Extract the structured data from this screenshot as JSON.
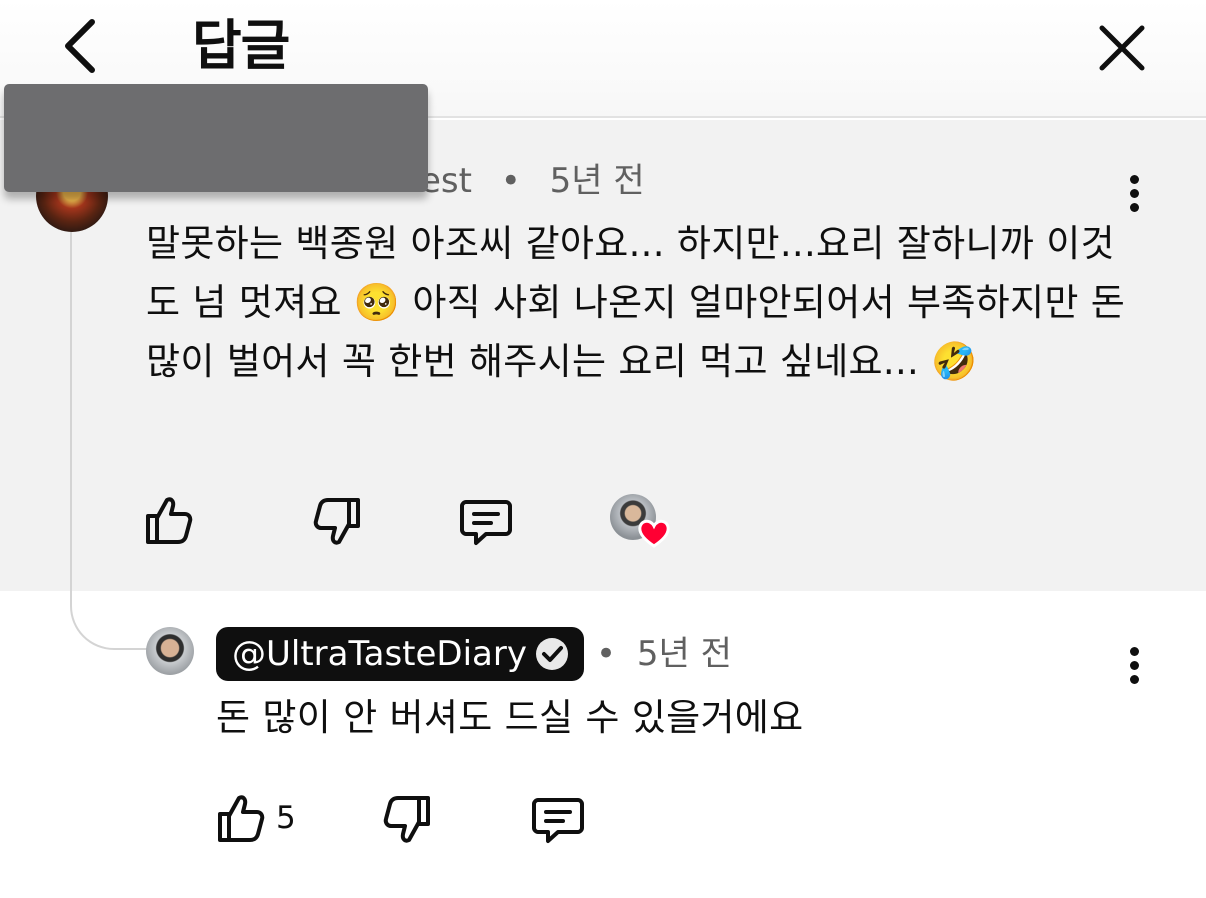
{
  "header": {
    "title": "답글",
    "back_icon": "chevron-left-icon",
    "close_icon": "close-icon"
  },
  "parent_comment": {
    "author_visible_fragment": "est",
    "separator": "•",
    "time": "5년 전",
    "text": "말못하는 백종원 아조씨 같아요... 하지만...요리 잘하니까 이것도 넘 멋져요 🥺 아직 사회 나온지 얼마안되어서 부족하지만 돈 많이 벌어서 꼭 한번 해주시는 요리 먹고 싶네요... 🤣",
    "emojis": [
      "🥺",
      "🤣"
    ],
    "icons": [
      "thumbs-up-icon",
      "thumbs-down-icon",
      "reply-icon",
      "creator-heart-icon"
    ],
    "colors": {
      "panel_bg": "#f2f2f2",
      "heart": "#ff0033"
    }
  },
  "reply": {
    "handle": "@UltraTasteDiary",
    "verified": true,
    "separator": "•",
    "time": "5년 전",
    "text": "돈 많이 안 버셔도 드실 수 있을거에요",
    "like_count": "5",
    "icons": [
      "thumbs-up-icon",
      "thumbs-down-icon",
      "reply-icon"
    ],
    "colors": {
      "badge_bg": "#0f0f0f",
      "badge_text": "#ffffff"
    }
  }
}
